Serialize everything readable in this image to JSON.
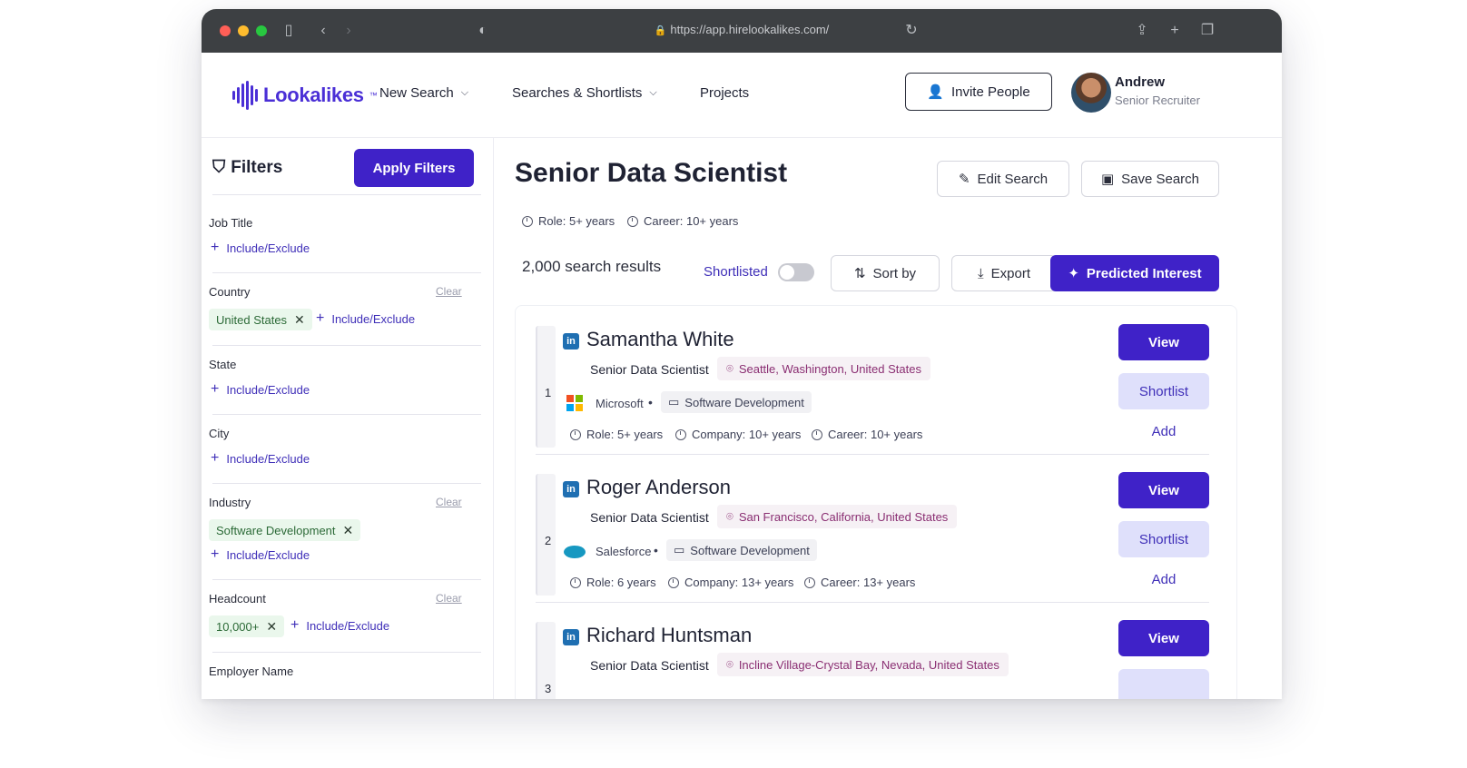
{
  "browser": {
    "url": "https://app.hirelookalikes.com/"
  },
  "header": {
    "logo_text": "Lookalikes",
    "logo_tm": "™",
    "nav": [
      {
        "label": "New Search"
      },
      {
        "label": "Searches & Shortlists"
      },
      {
        "label": "Projects"
      }
    ],
    "invite_label": "Invite People",
    "user": {
      "name": "Andrew",
      "role": "Senior Recruiter"
    }
  },
  "sidebar": {
    "title": "Filters",
    "apply_label": "Apply Filters",
    "include_exclude": "Include/Exclude",
    "clear": "Clear",
    "filters": {
      "job_title": "Job Title",
      "country": "Country",
      "country_chip": "United States",
      "state": "State",
      "city": "City",
      "industry": "Industry",
      "industry_chip": "Software Development",
      "headcount": "Headcount",
      "headcount_chip": "10,000+",
      "employer_name": "Employer Name"
    }
  },
  "main": {
    "title": "Senior Data Scientist",
    "role_meta": "Role: 5+ years",
    "career_meta": "Career: 10+ years",
    "edit_label": "Edit Search",
    "save_label": "Save Search",
    "results_count": "2,000 search results",
    "shortlisted_label": "Shortlisted",
    "sort_label": "Sort by",
    "export_label": "Export",
    "predicted_label": "Predicted Interest",
    "view_label": "View",
    "shortlist_label": "Shortlist",
    "add_label": "Add",
    "candidates": [
      {
        "rank": "1",
        "name": "Samantha White",
        "title": "Senior Data Scientist",
        "location": "Seattle, Washington, United States",
        "company": "Microsoft",
        "industry": "Software Development",
        "role": "Role: 5+ years",
        "company_tenure": "Company: 10+ years",
        "career": "Career: 10+ years"
      },
      {
        "rank": "2",
        "name": "Roger Anderson",
        "title": "Senior Data Scientist",
        "location": "San Francisco, California, United States",
        "company": "Salesforce",
        "industry": "Software Development",
        "role": "Role: 6 years",
        "company_tenure": "Company: 13+ years",
        "career": "Career: 13+ years"
      },
      {
        "rank": "3",
        "name": "Richard Huntsman",
        "title": "Senior Data Scientist",
        "location": "Incline Village-Crystal Bay, Nevada, United States"
      }
    ]
  },
  "colors": {
    "brand": "#3f22c8",
    "accent_light": "#dfe0fb",
    "chip_green": "#eaf7ec"
  }
}
